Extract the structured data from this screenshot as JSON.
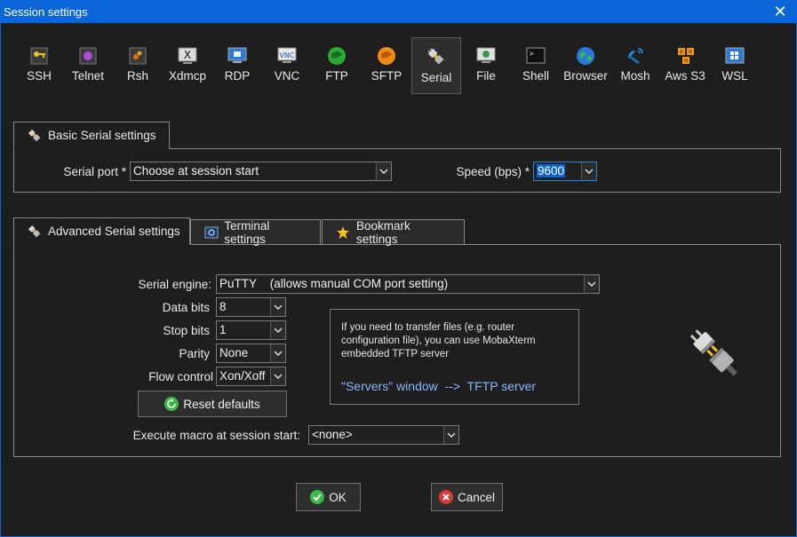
{
  "window": {
    "title": "Session settings"
  },
  "session_types": [
    {
      "label": "SSH",
      "icon": "key-icon"
    },
    {
      "label": "Telnet",
      "icon": "telnet-icon"
    },
    {
      "label": "Rsh",
      "icon": "rsh-icon"
    },
    {
      "label": "Xdmcp",
      "icon": "xdmcp-icon"
    },
    {
      "label": "RDP",
      "icon": "rdp-icon"
    },
    {
      "label": "VNC",
      "icon": "vnc-icon"
    },
    {
      "label": "FTP",
      "icon": "ftp-icon"
    },
    {
      "label": "SFTP",
      "icon": "sftp-icon"
    },
    {
      "label": "Serial",
      "icon": "serial-plug-icon",
      "active": true
    },
    {
      "label": "File",
      "icon": "file-icon"
    },
    {
      "label": "Shell",
      "icon": "shell-icon"
    },
    {
      "label": "Browser",
      "icon": "globe-icon"
    },
    {
      "label": "Mosh",
      "icon": "satellite-icon"
    },
    {
      "label": "Aws S3",
      "icon": "aws-s3-icon"
    },
    {
      "label": "WSL",
      "icon": "windows-icon"
    }
  ],
  "basic": {
    "tab_label": "Basic Serial settings",
    "serial_port_label": "Serial port *",
    "serial_port_value": "Choose at session start",
    "speed_label": "Speed (bps) *",
    "speed_value": "9600"
  },
  "advanced_tabs": [
    {
      "label": "Advanced Serial settings",
      "icon": "serial-plug-icon",
      "active": true
    },
    {
      "label": "Terminal settings",
      "icon": "terminal-settings-icon"
    },
    {
      "label": "Bookmark settings",
      "icon": "star-icon"
    }
  ],
  "advanced": {
    "serial_engine_label": "Serial engine:",
    "serial_engine_value": "PuTTY    (allows manual COM port setting)",
    "data_bits_label": "Data bits",
    "data_bits_value": "8",
    "stop_bits_label": "Stop bits",
    "stop_bits_value": "1",
    "parity_label": "Parity",
    "parity_value": "None",
    "flow_control_label": "Flow control",
    "flow_control_value": "Xon/Xoff",
    "reset_label": "Reset defaults",
    "macro_label": "Execute macro at session start:",
    "macro_value": "<none>",
    "info_text": "If you need to transfer files (e.g. router configuration file), you can use MobaXterm embedded TFTP server",
    "info_link": "\"Servers\" window  -->  TFTP server"
  },
  "buttons": {
    "ok": "OK",
    "cancel": "Cancel"
  },
  "colors": {
    "titlebar": "#0a66d8",
    "accent": "#0a66d8",
    "link": "#8ab8ff"
  }
}
